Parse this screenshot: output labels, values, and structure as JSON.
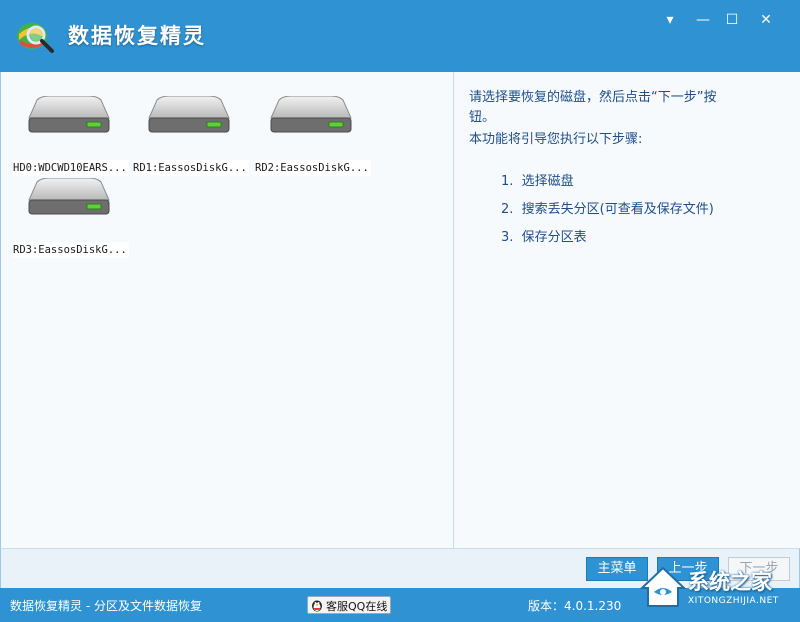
{
  "app": {
    "title": "数据恢复精灵"
  },
  "window_controls": {
    "menu": "▾",
    "minimize": "—",
    "maximize": "☐",
    "close": "✕"
  },
  "disks": [
    {
      "label": "HD0:WDCWD10EARS..."
    },
    {
      "label": "RD1:EassosDiskG..."
    },
    {
      "label": "RD2:EassosDiskG..."
    },
    {
      "label": "RD3:EassosDiskG..."
    }
  ],
  "instructions": {
    "line1": "请选择要恢复的磁盘，然后点击“下一步”按",
    "line1b": "钮。",
    "line2": "本功能将引导您执行以下步骤:",
    "steps": [
      {
        "num": "1.",
        "text": "选择磁盘"
      },
      {
        "num": "2.",
        "text": "搜索丢失分区(可查看及保存文件)"
      },
      {
        "num": "3.",
        "text": "保存分区表"
      }
    ]
  },
  "buttons": {
    "main_menu": "主菜单",
    "prev": "上一步",
    "next": "下一步"
  },
  "status": {
    "left": "数据恢复精灵 - 分区及文件数据恢复",
    "qq": "客服QQ在线",
    "version": "版本：4.0.1.230"
  },
  "watermark": {
    "text": "系统之家",
    "sub": "XITONGZHIJIA.NET"
  },
  "colors": {
    "accent": "#2f93d3",
    "pane_bg": "#f6fafd",
    "text_blue": "#1f4e8a"
  }
}
